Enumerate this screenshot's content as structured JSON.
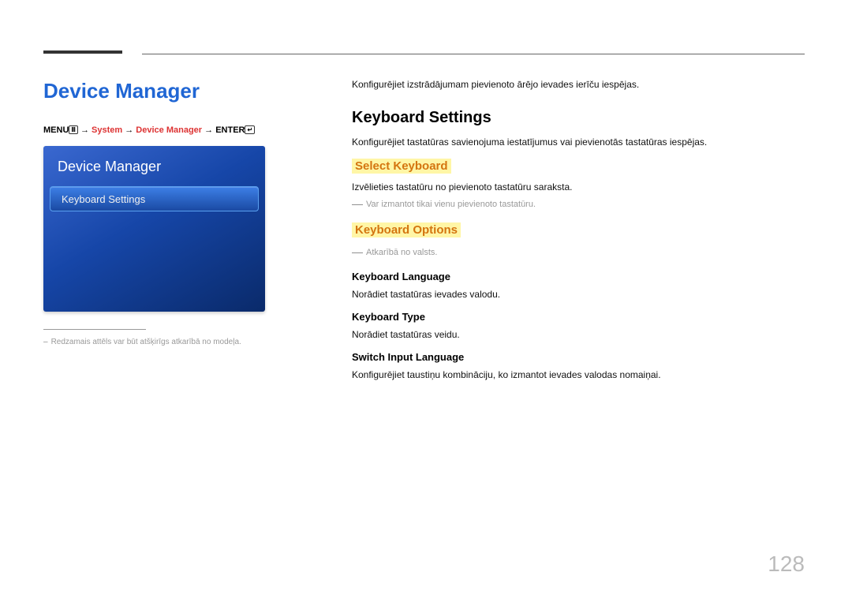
{
  "page_number": "128",
  "left": {
    "heading": "Device Manager",
    "breadcrumb": {
      "menu": "MENU",
      "arrow": " → ",
      "p1": "System",
      "p2": "Device Manager",
      "enter": "ENTER"
    },
    "osd": {
      "title": "Device Manager",
      "item": "Keyboard Settings"
    },
    "footnote": "Redzamais attēls var būt atšķirīgs atkarībā no modeļa."
  },
  "right": {
    "intro": "Konfigurējiet izstrādājumam pievienoto ārējo ievades ierīču iespējas.",
    "h2": "Keyboard Settings",
    "h2_body": "Konfigurējiet tastatūras savienojuma iestatījumus vai pievienotās tastatūras iespējas.",
    "select_kb": "Select Keyboard",
    "select_kb_body": "Izvēlieties tastatūru no pievienoto tastatūru saraksta.",
    "select_kb_note": "Var izmantot tikai vienu pievienoto tastatūru.",
    "kb_options": "Keyboard Options",
    "kb_options_note": "Atkarībā no valsts.",
    "kb_lang": "Keyboard Language",
    "kb_lang_body": "Norādiet tastatūras ievades valodu.",
    "kb_type": "Keyboard Type",
    "kb_type_body": "Norādiet tastatūras veidu.",
    "switch_lang": "Switch Input Language",
    "switch_lang_body": "Konfigurējiet taustiņu kombināciju, ko izmantot ievades valodas nomaiņai."
  }
}
